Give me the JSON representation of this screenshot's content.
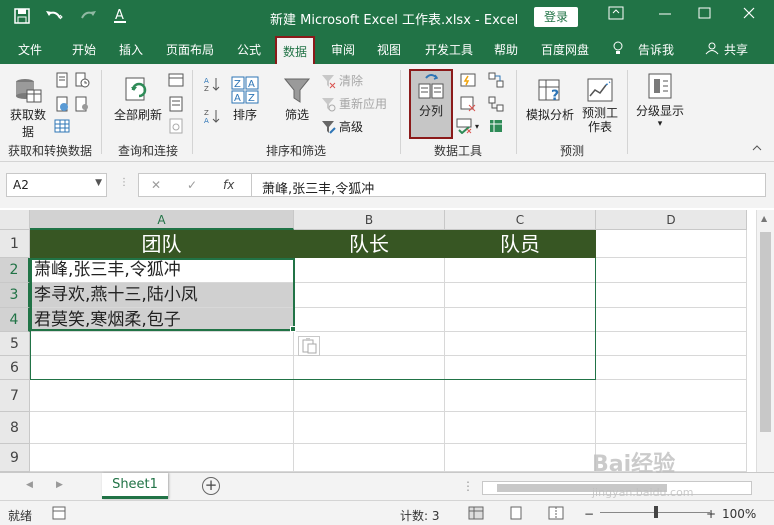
{
  "titlebar": {
    "title": "新建 Microsoft Excel 工作表.xlsx  -  Excel",
    "login": "登录",
    "qat": {
      "save_icon": "save-icon",
      "undo_icon": "undo-icon",
      "redo_icon": "redo-icon",
      "font_color_icon": "font-color-icon"
    }
  },
  "menu": {
    "tabs": [
      "文件",
      "开始",
      "插入",
      "页面布局",
      "公式",
      "数据",
      "审阅",
      "视图",
      "开发工具",
      "帮助",
      "百度网盘"
    ],
    "active": "数据",
    "tell_me": "告诉我",
    "share": "共享"
  },
  "ribbon": {
    "get_data": "获取数据",
    "get_data_group": "获取和转换数据",
    "refresh_all": "全部刷新",
    "query_group": "查询和连接",
    "sort": "排序",
    "filter": "筛选",
    "clear": "清除",
    "reapply": "重新应用",
    "advanced": "高级",
    "sort_filter_group": "排序和筛选",
    "text_to_columns": "分列",
    "data_tools_group": "数据工具",
    "what_if": "模拟分析",
    "forecast_sheet": "预测工作表",
    "forecast_group": "预测",
    "outline": "分级显示"
  },
  "formula_bar": {
    "name_box": "A2",
    "cancel": "✕",
    "enter": "✓",
    "fx": "fx",
    "content": "萧峰,张三丰,令狐冲"
  },
  "sheet": {
    "columns": [
      "A",
      "B",
      "C",
      "D"
    ],
    "rows": [
      "1",
      "2",
      "3",
      "4",
      "5",
      "6",
      "7",
      "8",
      "9"
    ],
    "header_row": [
      "团队",
      "队长",
      "队员"
    ],
    "data": [
      "萧峰,张三丰,令狐冲",
      "李寻欢,燕十三,陆小凤",
      "君莫笑,寒烟柔,包子"
    ],
    "header_color": "#375623",
    "selected_color": "#d0d0d0"
  },
  "tabs": {
    "sheet1": "Sheet1",
    "add": "+"
  },
  "status": {
    "mode": "就绪",
    "count": "计数: 3",
    "zoom": "100%"
  },
  "watermark": {
    "text": "Bai经验",
    "url": "jingyan.baidu.com"
  }
}
